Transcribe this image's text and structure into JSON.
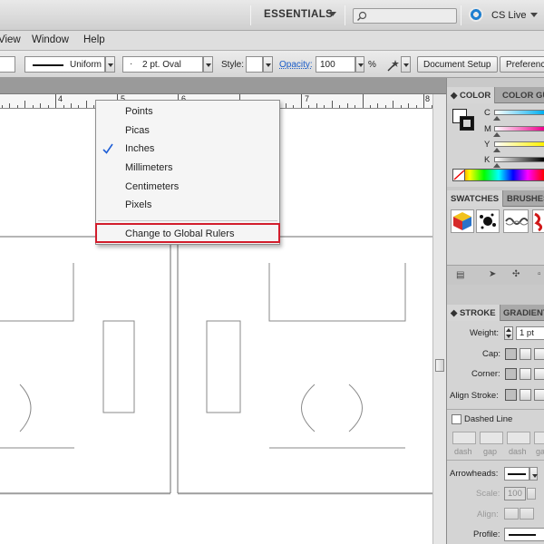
{
  "app": {
    "workspace_label": "ESSENTIALS",
    "search_placeholder": "",
    "cs_live_label": "CS Live"
  },
  "menubar": {
    "items": [
      "View",
      "Window",
      "Help"
    ]
  },
  "control_bar": {
    "stroke_profile": "Uniform",
    "brush": "2 pt. Oval",
    "style_label": "Style:",
    "opacity_label": "Opacity:",
    "opacity_value": "100",
    "opacity_unit": "%",
    "document_setup_label": "Document Setup",
    "preferences_label": "Preferences"
  },
  "ruler": {
    "ticks": [
      "4",
      "5",
      "6",
      "7",
      "8"
    ]
  },
  "context_menu": {
    "items": [
      "Points",
      "Picas",
      "Inches",
      "Millimeters",
      "Centimeters",
      "Pixels"
    ],
    "checked_item": "Inches",
    "global_rulers_label": "Change to Global Rulers",
    "highlight_color": "#d21d2c"
  },
  "panels": {
    "color_tabs": [
      "COLOR",
      "COLOR GUIDE"
    ],
    "color_channels": [
      "C",
      "M",
      "Y",
      "K"
    ],
    "swatches_tabs": [
      "SWATCHES",
      "BRUSHES"
    ],
    "stroke_tabs": [
      "STROKE",
      "GRADIENT"
    ],
    "weight_label": "Weight:",
    "weight_value": "1 pt",
    "cap_label": "Cap:",
    "corner_label": "Corner:",
    "align_stroke_label": "Align Stroke:",
    "dashed_line_label": "Dashed Line",
    "dash_labels": [
      "dash",
      "gap",
      "dash",
      "gap"
    ],
    "arrowheads_label": "Arrowheads:",
    "scale_label": "Scale:",
    "scale_value": "100",
    "align_label": "Align:",
    "profile_label": "Profile:"
  }
}
